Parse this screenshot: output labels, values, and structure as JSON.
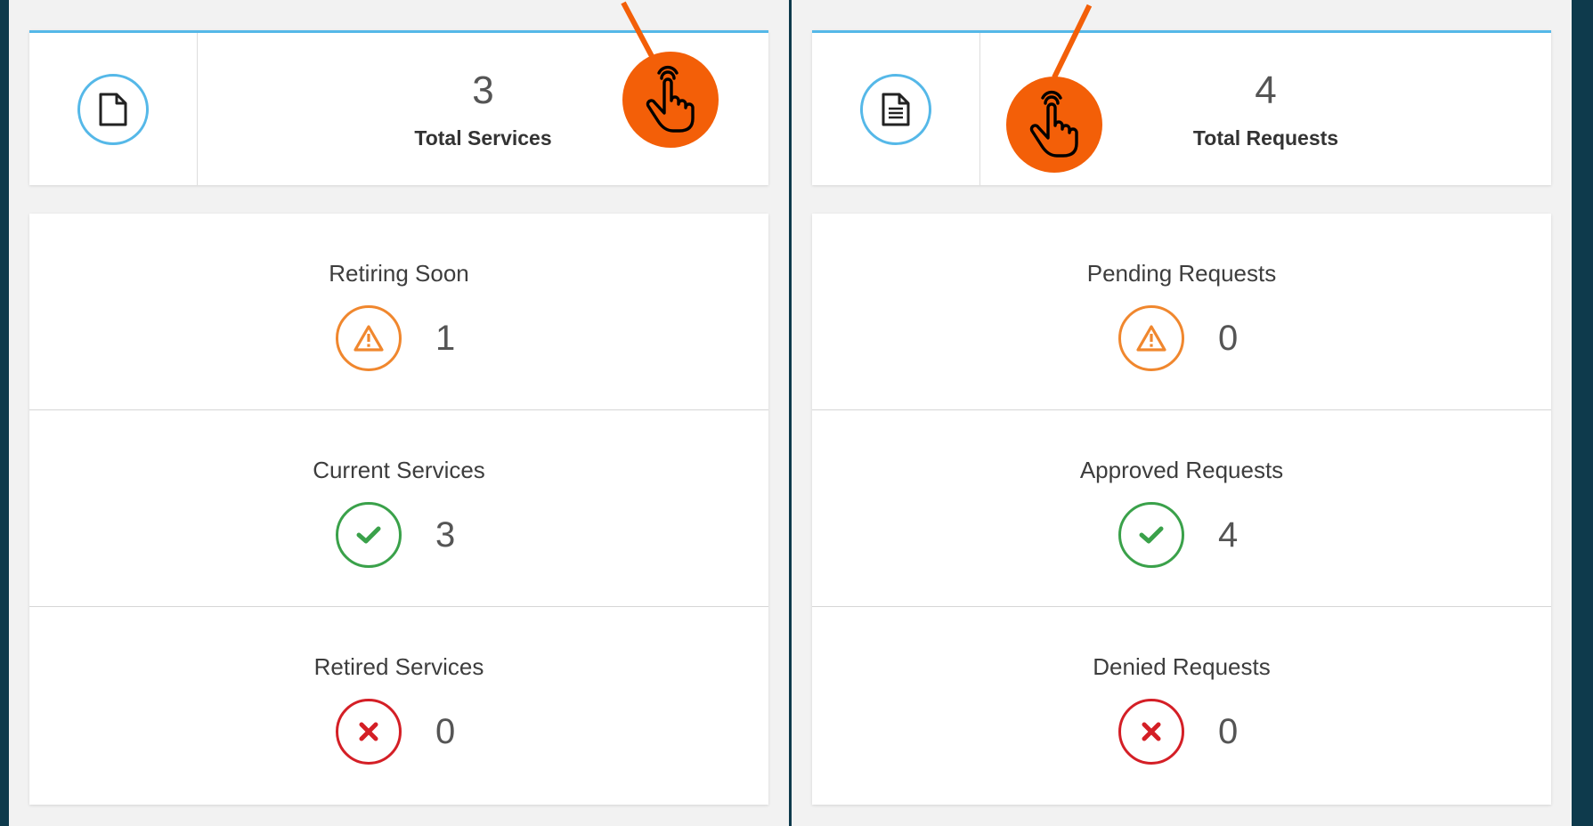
{
  "services": {
    "total_value": "3",
    "total_label": "Total Services",
    "total_icon": "file-icon",
    "stats": [
      {
        "label": "Retiring Soon",
        "value": "1",
        "icon": "warning-icon",
        "color": "#f0872e"
      },
      {
        "label": "Current Services",
        "value": "3",
        "icon": "check-icon",
        "color": "#3aa14a"
      },
      {
        "label": "Retired Services",
        "value": "0",
        "icon": "close-icon",
        "color": "#d41f26"
      }
    ]
  },
  "requests": {
    "total_value": "4",
    "total_label": "Total Requests",
    "total_icon": "document-text-icon",
    "stats": [
      {
        "label": "Pending Requests",
        "value": "0",
        "icon": "warning-icon",
        "color": "#f0872e"
      },
      {
        "label": "Approved Requests",
        "value": "4",
        "icon": "check-icon",
        "color": "#3aa14a"
      },
      {
        "label": "Denied Requests",
        "value": "0",
        "icon": "close-icon",
        "color": "#d41f26"
      }
    ]
  },
  "colors": {
    "background": "#0e3a4c",
    "accent": "#55b8e8",
    "annotation": "#f35f08"
  }
}
